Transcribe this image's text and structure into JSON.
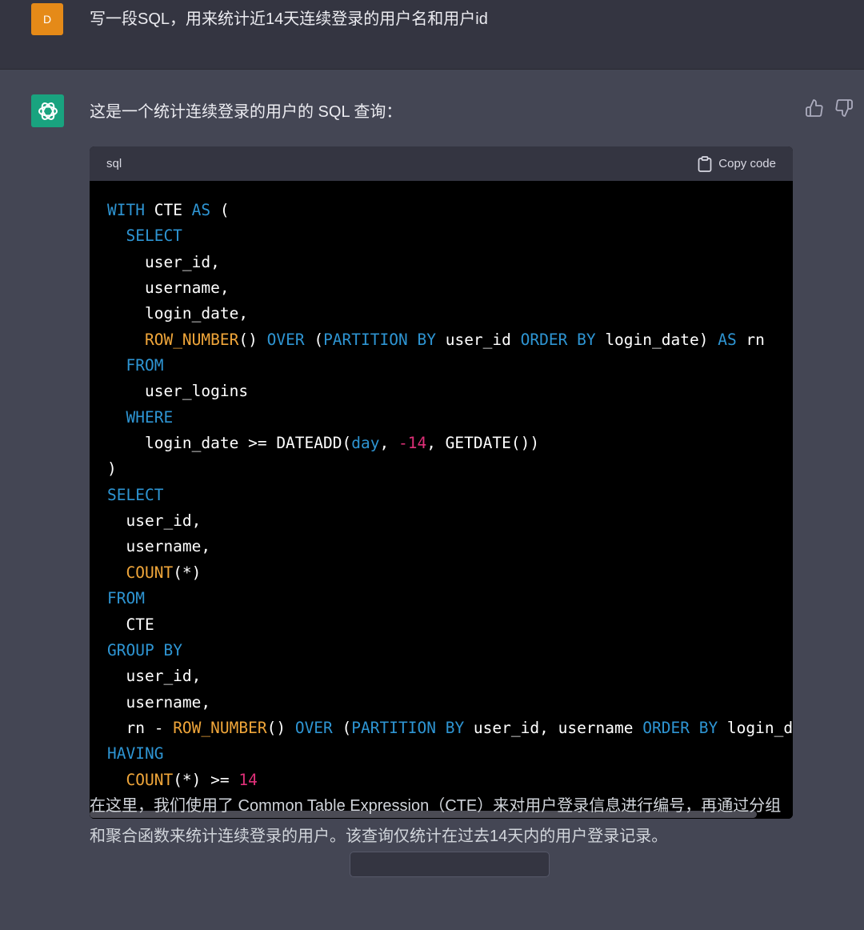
{
  "user_message": {
    "avatar_letter": "D",
    "text": "写一段SQL，用来统计近14天连续登录的用户名和用户id"
  },
  "assistant_message": {
    "intro": "这是一个统计连续登录的用户的 SQL 查询：",
    "code_block": {
      "language": "sql",
      "copy_label": "Copy code"
    },
    "explanation": "在这里，我们使用了 Common Table Expression（CTE）来对用户登录信息进行编号，再通过分组和聚合函数来统计连续登录的用户。该查询仅统计在过去14天内的用户登录记录。"
  },
  "code_lines": [
    [
      {
        "t": "WITH",
        "c": "kw"
      },
      {
        "t": " CTE "
      },
      {
        "t": "AS",
        "c": "kw"
      },
      {
        "t": " ("
      }
    ],
    [
      {
        "t": "  "
      },
      {
        "t": "SELECT",
        "c": "kw"
      }
    ],
    [
      {
        "t": "    user_id,"
      }
    ],
    [
      {
        "t": "    username,"
      }
    ],
    [
      {
        "t": "    login_date,"
      }
    ],
    [
      {
        "t": "    "
      },
      {
        "t": "ROW_NUMBER",
        "c": "fn"
      },
      {
        "t": "() "
      },
      {
        "t": "OVER",
        "c": "kw"
      },
      {
        "t": " ("
      },
      {
        "t": "PARTITION",
        "c": "kw"
      },
      {
        "t": " "
      },
      {
        "t": "BY",
        "c": "kw"
      },
      {
        "t": " user_id "
      },
      {
        "t": "ORDER",
        "c": "kw"
      },
      {
        "t": " "
      },
      {
        "t": "BY",
        "c": "kw"
      },
      {
        "t": " login_date) "
      },
      {
        "t": "AS",
        "c": "kw"
      },
      {
        "t": " rn"
      }
    ],
    [
      {
        "t": "  "
      },
      {
        "t": "FROM",
        "c": "kw"
      }
    ],
    [
      {
        "t": "    user_logins"
      }
    ],
    [
      {
        "t": "  "
      },
      {
        "t": "WHERE",
        "c": "kw"
      }
    ],
    [
      {
        "t": "    login_date >= DATEADD("
      },
      {
        "t": "day",
        "c": "kw"
      },
      {
        "t": ", "
      },
      {
        "t": "-14",
        "c": "num"
      },
      {
        "t": ", GETDATE())"
      }
    ],
    [
      {
        "t": ")"
      }
    ],
    [
      {
        "t": "SELECT",
        "c": "kw"
      }
    ],
    [
      {
        "t": "  user_id,"
      }
    ],
    [
      {
        "t": "  username,"
      }
    ],
    [
      {
        "t": "  "
      },
      {
        "t": "COUNT",
        "c": "fn"
      },
      {
        "t": "(*)"
      }
    ],
    [
      {
        "t": "FROM",
        "c": "kw"
      }
    ],
    [
      {
        "t": "  CTE"
      }
    ],
    [
      {
        "t": "GROUP",
        "c": "kw"
      },
      {
        "t": " "
      },
      {
        "t": "BY",
        "c": "kw"
      }
    ],
    [
      {
        "t": "  user_id,"
      }
    ],
    [
      {
        "t": "  username,"
      }
    ],
    [
      {
        "t": "  rn - "
      },
      {
        "t": "ROW_NUMBER",
        "c": "fn"
      },
      {
        "t": "() "
      },
      {
        "t": "OVER",
        "c": "kw"
      },
      {
        "t": " ("
      },
      {
        "t": "PARTITION",
        "c": "kw"
      },
      {
        "t": " "
      },
      {
        "t": "BY",
        "c": "kw"
      },
      {
        "t": " user_id, username "
      },
      {
        "t": "ORDER",
        "c": "kw"
      },
      {
        "t": " "
      },
      {
        "t": "BY",
        "c": "kw"
      },
      {
        "t": " login_date"
      }
    ],
    [
      {
        "t": "HAVING",
        "c": "kw"
      }
    ],
    [
      {
        "t": "  "
      },
      {
        "t": "COUNT",
        "c": "fn"
      },
      {
        "t": "(*) >= "
      },
      {
        "t": "14",
        "c": "num"
      }
    ]
  ],
  "colors": {
    "page_bg": "#444654",
    "user_row_bg": "#343541",
    "user_avatar": "#e58a18",
    "bot_avatar": "#19a37f",
    "code_bg": "#000000",
    "keyword": "#2e95d3",
    "function": "#f0a63a",
    "number": "#df3079"
  },
  "icons": [
    "openai-logo-icon",
    "thumbs-up-icon",
    "thumbs-down-icon",
    "clipboard-icon"
  ]
}
